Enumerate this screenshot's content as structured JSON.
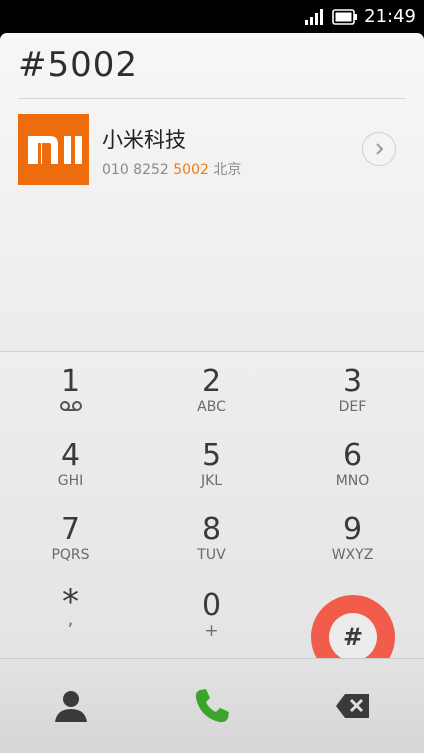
{
  "status_bar": {
    "time": "21:49",
    "icons": [
      "signal-icon",
      "battery-icon"
    ]
  },
  "dialer": {
    "input": "#5002"
  },
  "contact": {
    "name": "小米科技",
    "number_prefix": "010 8252 ",
    "number_match": "5002",
    "location": "北京",
    "avatar_logo": "MI",
    "brand_color": "#ef6c0c",
    "highlight_color": "#f07a0c"
  },
  "keypad": {
    "keys": [
      {
        "digit": "1",
        "letters": "",
        "icon": "voicemail-icon"
      },
      {
        "digit": "2",
        "letters": "ABC"
      },
      {
        "digit": "3",
        "letters": "DEF"
      },
      {
        "digit": "4",
        "letters": "GHI"
      },
      {
        "digit": "5",
        "letters": "JKL"
      },
      {
        "digit": "6",
        "letters": "MNO"
      },
      {
        "digit": "7",
        "letters": "PQRS"
      },
      {
        "digit": "8",
        "letters": "TUV"
      },
      {
        "digit": "9",
        "letters": "WXYZ"
      },
      {
        "digit": "*",
        "letters": ","
      },
      {
        "digit": "0",
        "letters": "+"
      },
      {
        "digit": "#",
        "letters": ""
      }
    ],
    "highlight_color": "#f25c4a"
  },
  "bottom_bar": {
    "items": [
      "contacts-icon",
      "call-icon",
      "backspace-icon"
    ],
    "call_color": "#3aa52a"
  }
}
